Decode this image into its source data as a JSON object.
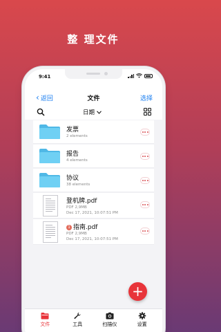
{
  "headline": "整 理文件",
  "status": {
    "time": "9:41"
  },
  "nav": {
    "back_label": "返回",
    "title": "文件",
    "select_label": "选择"
  },
  "toolbar": {
    "sort_label": "日期"
  },
  "folders": [
    {
      "name": "发票",
      "meta": "2 elements"
    },
    {
      "name": "报告",
      "meta": "4 elements"
    },
    {
      "name": "协议",
      "meta": "38 elements"
    }
  ],
  "files": [
    {
      "name": "登机牌.pdf",
      "size": "PDF 2,9MB",
      "date": "Dec 17, 2021, 10:07:51 PM",
      "badge": ""
    },
    {
      "name": "指南.pdf",
      "size": "PDF 2,9MB",
      "date": "Dec 17, 2021, 10:07:51 PM",
      "badge": "1"
    }
  ],
  "fab_label": "+",
  "tabs": [
    {
      "label": "文件",
      "icon": "folder-icon",
      "active": true
    },
    {
      "label": "工具",
      "icon": "wrench-icon",
      "active": false
    },
    {
      "label": "扫描仪",
      "icon": "camera-icon",
      "active": false
    },
    {
      "label": "设置",
      "icon": "gear-icon",
      "active": false
    }
  ],
  "colors": {
    "accent": "#e8343a",
    "link": "#1a7ef0",
    "folder": "#5fc8ef"
  }
}
